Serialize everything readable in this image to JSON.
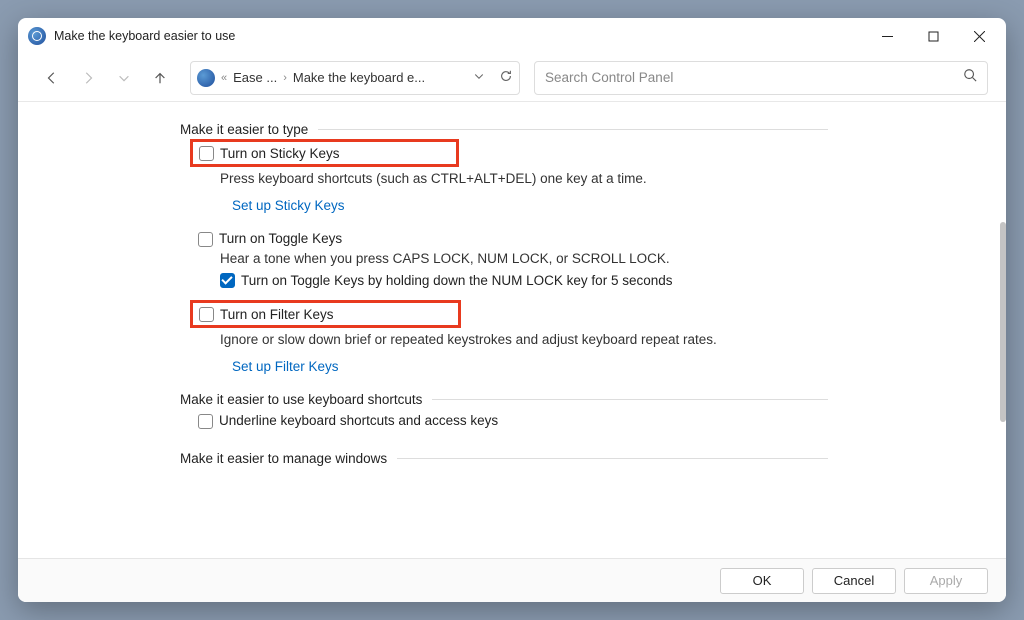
{
  "title": "Make the keyboard easier to use",
  "breadcrumb": {
    "prefix": "«",
    "part1": "Ease ...",
    "part2": "Make the keyboard e..."
  },
  "search_placeholder": "Search Control Panel",
  "sections": {
    "type": {
      "heading": "Make it easier to type",
      "sticky_label": "Turn on Sticky Keys",
      "sticky_desc": "Press keyboard shortcuts (such as CTRL+ALT+DEL) one key at a time.",
      "sticky_link": "Set up Sticky Keys",
      "toggle_label": "Turn on Toggle Keys",
      "toggle_desc": "Hear a tone when you press CAPS LOCK, NUM LOCK, or SCROLL LOCK.",
      "toggle_hold_label": "Turn on Toggle Keys by holding down the NUM LOCK key for 5 seconds",
      "filter_label": "Turn on Filter Keys",
      "filter_desc": "Ignore or slow down brief or repeated keystrokes and adjust keyboard repeat rates.",
      "filter_link": "Set up Filter Keys"
    },
    "shortcuts": {
      "heading": "Make it easier to use keyboard shortcuts",
      "underline_label": "Underline keyboard shortcuts and access keys"
    },
    "windows": {
      "heading": "Make it easier to manage windows"
    }
  },
  "buttons": {
    "ok": "OK",
    "cancel": "Cancel",
    "apply": "Apply"
  }
}
